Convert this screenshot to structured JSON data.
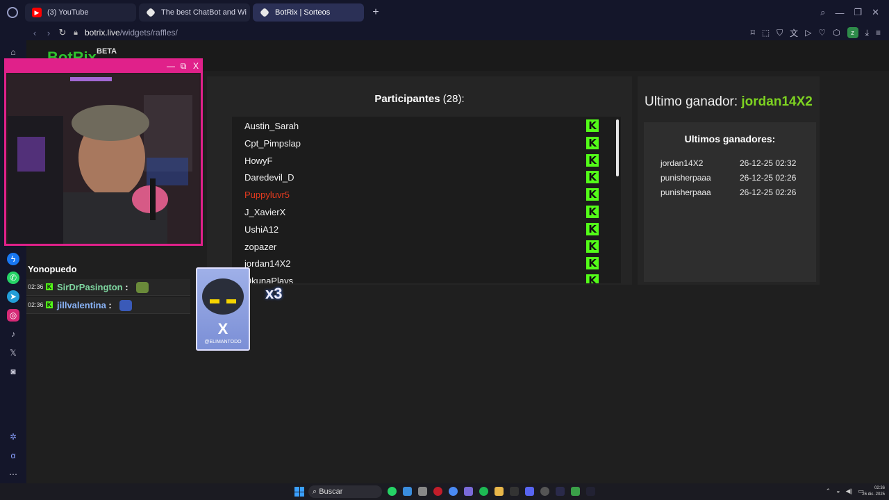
{
  "browser": {
    "tabs": [
      {
        "label": "(3) YouTube",
        "icon": "youtube-icon",
        "active": false
      },
      {
        "label": "The best ChatBot and Wi",
        "icon": "botrix-icon",
        "active": false
      },
      {
        "label": "BotRix | Sorteos",
        "icon": "botrix-icon",
        "active": true
      }
    ],
    "url_host": "botrix.live",
    "url_path": "/widgets/raffles/",
    "profile_initial": "z"
  },
  "header": {
    "logo": "BotRix",
    "beta": "BETA"
  },
  "participants": {
    "title": "Participantes",
    "count": "(28):",
    "items": [
      {
        "name": "Austin_Sarah",
        "highlight": false
      },
      {
        "name": "Cpt_Pimpslap",
        "highlight": false
      },
      {
        "name": "HowyF",
        "highlight": false
      },
      {
        "name": "Daredevil_D",
        "highlight": false
      },
      {
        "name": "Puppyluvr5",
        "highlight": true
      },
      {
        "name": "J_XavierX",
        "highlight": false
      },
      {
        "name": "UshiA12",
        "highlight": false
      },
      {
        "name": "zopazer",
        "highlight": false
      },
      {
        "name": "jordan14X2",
        "highlight": false
      },
      {
        "name": "OkunaPlays",
        "highlight": false
      }
    ],
    "badge_letter": "K"
  },
  "winners": {
    "last_label": "Ultimo ganador:",
    "last_name": "jordan14X2",
    "list_title": "Ultimos ganadores:",
    "rows": [
      {
        "name": "jordan14X2",
        "date": "26-12-25 02:32"
      },
      {
        "name": "punisherpaaa",
        "date": "26-12-25 02:26"
      },
      {
        "name": "punisherpaaa",
        "date": "26-12-25 02:26"
      }
    ]
  },
  "chat": {
    "header": "Yonopuedo",
    "messages": [
      {
        "time": "02:36",
        "user": "SirDrPasington",
        "suffix": " :",
        "color": "#7ed6a0"
      },
      {
        "time": "02:36",
        "user": "jillvalentina",
        "suffix": " :",
        "color": "#8ab4f8"
      }
    ]
  },
  "overlay": {
    "sticker_mark": "X",
    "sticker_handle": "@ELIMANTODO",
    "multiplier": "x3"
  },
  "webcam_controls": {
    "minimize": "—",
    "restore": "⧉",
    "close": "X"
  },
  "taskbar": {
    "search_label": "Buscar",
    "time": "02:36",
    "date": "26 dic. 2025"
  },
  "colors": {
    "accent_pink": "#e0218a",
    "kick_green": "#53fc18",
    "winner_green": "#7ed321",
    "highlight_red": "#e53b1f"
  }
}
